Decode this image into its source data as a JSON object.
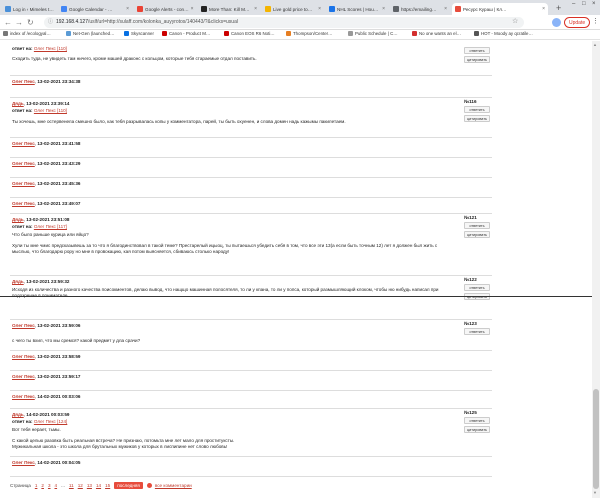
{
  "tabs": [
    {
      "title": "Log in ‹ Mimeles t…",
      "color": "#4a90d9"
    },
    {
      "title": "Google Calendar - …",
      "color": "#4285f4"
    },
    {
      "title": "Google Alerts - con…",
      "color": "#ea4335"
    },
    {
      "title": "More Than: Kill M…",
      "color": "#222222"
    },
    {
      "title": "Live gold price to…",
      "color": "#f4b400"
    },
    {
      "title": "NHL Scores | Hou…",
      "color": "#1a73e8"
    },
    {
      "title": "https://emailing…",
      "color": "#5f6368"
    },
    {
      "title": "Ресурс Кураш | Кл…",
      "color": "#e74c3c"
    }
  ],
  "address": {
    "host": "192.168.4.127",
    "path": "/uslf/url=http://sulaff.com/kolonka_auyyrotos/140443/?&clicks=usual"
  },
  "update_label": "Update",
  "bookmarks": [
    "index of /ecologyal…",
    "Net-Gen (launched…",
    "Skyscanner",
    "Canon - Product M…",
    "Canon EOS R6 Noti…",
    "Thompson/Center…",
    "Public Schedule | C…",
    "No one wants an el…",
    "HOT - Moody ay qcratile…"
  ],
  "top": [
    {
      "date": "",
      "reply_label": "ответ на:",
      "reply_to": "Олег Пекс [110]",
      "body": "Сходить туда, не увидеть там ничего, кроме машей драконс с кольцом, которые тебя стараемые отдал поставить."
    },
    {
      "author": "Олег Пекс",
      "date": "13-02-2021 23:34:38"
    },
    {
      "author": "Дядь",
      "date": "13-02-2021 23:39:14",
      "reply_label": "ответ на:",
      "reply_to": "Олег Пекс [110]",
      "num": "№116",
      "body": "Ты хочешь, мне остервенела смешно было, как тебя разрывалась копы у комментатора, парей, ты быть охуенен, и слова домен надь кажымы пакилетаем."
    },
    {
      "author": "Олег Пекс",
      "date": "13-02-2021 23:41:58"
    },
    {
      "author": "Олег Пекс",
      "date": "13-02-2021 23:43:29"
    },
    {
      "author": "Олег Пекс",
      "date": "13-02-2021 23:45:36"
    },
    {
      "author": "Олег Пекс",
      "date": "13-02-2021 23:49:07"
    },
    {
      "author": "Дядь",
      "date": "13-02-2021 23:51:08",
      "reply_label": "ответ на:",
      "reply_to": "Олег Пекс [117]",
      "num": "№121",
      "body1": "Что было раньше курица или яйцо?",
      "body2": "Хули ты мне чмис предсказывешь за то что я благодинствовал в такой теме? Престарелый ицыоц, ты пытаешься убедить себя в том, что все эти 13(а если быть точным 12) лет я должен был жить с мыслью, что благодарю popу но мне в провокацию, кая потом выясняется, сбиваюсь столько народу!"
    },
    {
      "author": "Дядь",
      "date": "13-02-2021 23:59:32",
      "num": "№122",
      "body": "Исходя из количества и разного качества поисокментов, делаю вывод, что нащщо машинная полосятеля, то ли у кпана, то ли у попса, который размышляющий клоком, чтобы ню нибудь написал при подозрение в понимателе."
    },
    {
      "author": "Олег Пекс",
      "date": "13-02-2021 23:59:06",
      "num": "№123"
    }
  ],
  "bottom": [
    {
      "body": "с чего ты вхил, что мы сремся? какой предмет у дла срачи?"
    },
    {
      "author": "Олег Пекс",
      "date": "13-02-2021 23:58:59"
    },
    {
      "author": "Олег Пекс",
      "date": "13-02-2021 23:59:17"
    },
    {
      "author": "Олег Пекс",
      "date": "14-02-2021 00:03:06"
    },
    {
      "author": "Дядь",
      "date": "14-02-2021 00:03:59",
      "reply_label": "ответ на:",
      "reply_to": "Олег Пекс [124]",
      "num": "№125",
      "body1": "Вот тебя нерает, тьмы.",
      "body2": "С какой целью разовка быть реальная встреча? Не признаю, потомьта мне лет мало для проституксты.",
      "body3": "Мужикальная школа - это школа для брутальных мужиков у которых в лиспипине нет слово любовь!"
    },
    {
      "author": "Олег Пекс",
      "date": "14-02-2021 00:04:05"
    }
  ],
  "buttons": {
    "reply": "ответить",
    "quote": "цитировать"
  },
  "pager": {
    "label": "Страница",
    "pages": [
      "1",
      "2",
      "3",
      "4",
      "...",
      "11",
      "12",
      "13",
      "14",
      "15"
    ],
    "current": "последняя",
    "all": "все комментарии"
  }
}
